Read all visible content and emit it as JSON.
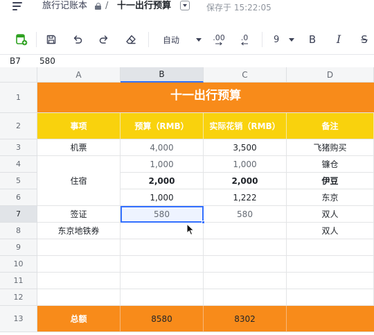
{
  "header": {
    "notebook": "旅行记账本",
    "separator": "/",
    "doc_title": "十一出行预算",
    "save_status": "保存于 15:22:05"
  },
  "toolbar": {
    "number_format": "自动",
    "decimal_increase": ".00",
    "decimal_decrease": ".0",
    "font_size": "9",
    "bold": "B",
    "italic": "I",
    "strike": "S"
  },
  "formula_bar": {
    "cell_ref": "B7",
    "value": "580"
  },
  "grid": {
    "columns": [
      "A",
      "B",
      "C",
      "D"
    ],
    "rows": [
      "1",
      "2",
      "3",
      "4",
      "5",
      "6",
      "7",
      "8",
      "9",
      "10",
      "11",
      "12",
      "13"
    ],
    "title": "十一出行预算",
    "headers": [
      "事项",
      "预算（RMB）",
      "实际花销（RMB）",
      "备注"
    ],
    "items": [
      {
        "item": "机票",
        "budget": "4,000",
        "actual": "3,500",
        "note": "飞猪购买"
      },
      {
        "item": "",
        "budget": "1,000",
        "actual": "1,000",
        "note": "镰仓"
      },
      {
        "item": "住宿",
        "budget": "2,000",
        "actual": "2,000",
        "note": "伊豆"
      },
      {
        "item": "",
        "budget": "1,000",
        "actual": "1,222",
        "note": "东京"
      },
      {
        "item": "签证",
        "budget": "580",
        "actual": "580",
        "note": "双人"
      },
      {
        "item": "东京地铁券",
        "budget": "",
        "actual": "",
        "note": "双人"
      }
    ],
    "total": {
      "label": "总额",
      "budget": "8580",
      "actual": "8302",
      "note": ""
    },
    "selected_cell": "B7"
  },
  "colors": {
    "title_fill": "#f88b1a",
    "header_fill": "#f9d20d",
    "total_fill": "#f88b1a",
    "selection": "#3370ff"
  },
  "icons": [
    "app-menu-icon",
    "lock-icon",
    "title-dropdown-icon",
    "add-sheet-icon",
    "save-icon",
    "undo-icon",
    "redo-icon",
    "eraser-icon"
  ]
}
